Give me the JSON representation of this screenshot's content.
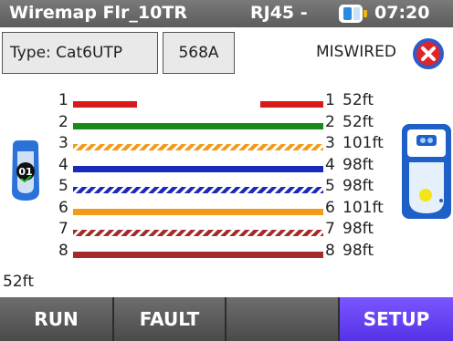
{
  "title_bar": {
    "title": "Wiremap  Flr_10TR",
    "connector": "RJ45 -",
    "battery_icon": "battery-icon",
    "time": "07:20"
  },
  "info": {
    "cable_type": "Type: Cat6UTP",
    "standard": "568A",
    "status": "MISWIRED",
    "status_icon": "error-x-icon",
    "status_color": "#e0242a"
  },
  "wiremap": {
    "pins": [
      {
        "near": "1",
        "far": "1",
        "length": "52ft",
        "color": "#d81a1a",
        "style": "solid",
        "open": true
      },
      {
        "near": "2",
        "far": "2",
        "length": "52ft",
        "color": "#1a8a1a",
        "style": "solid",
        "open": false
      },
      {
        "near": "3",
        "far": "3",
        "length": "101ft",
        "color": "#f39a1a",
        "style": "striped",
        "open": false
      },
      {
        "near": "4",
        "far": "4",
        "length": "98ft",
        "color": "#1a2ab8",
        "style": "solid",
        "open": false
      },
      {
        "near": "5",
        "far": "5",
        "length": "98ft",
        "color": "#1a2ab8",
        "style": "striped",
        "open": false
      },
      {
        "near": "6",
        "far": "6",
        "length": "101ft",
        "color": "#f39a1a",
        "style": "solid",
        "open": false
      },
      {
        "near": "7",
        "far": "7",
        "length": "98ft",
        "color": "#a52a2a",
        "style": "striped",
        "open": false
      },
      {
        "near": "8",
        "far": "8",
        "length": "98ft",
        "color": "#a52a2a",
        "style": "solid",
        "open": false
      }
    ],
    "main_unit_id": "01",
    "main_unit_icon": "tester-main-unit-icon",
    "remote_icon": "remote-unit-icon"
  },
  "cursor_length": "52ft",
  "softkeys": [
    {
      "label": "RUN"
    },
    {
      "label": "FAULT"
    },
    {
      "label": ""
    },
    {
      "label": "SETUP"
    }
  ],
  "colors": {
    "title_bar": "#666666",
    "softkey": "#5a5a5a",
    "setup_key": "#6a44f5"
  }
}
